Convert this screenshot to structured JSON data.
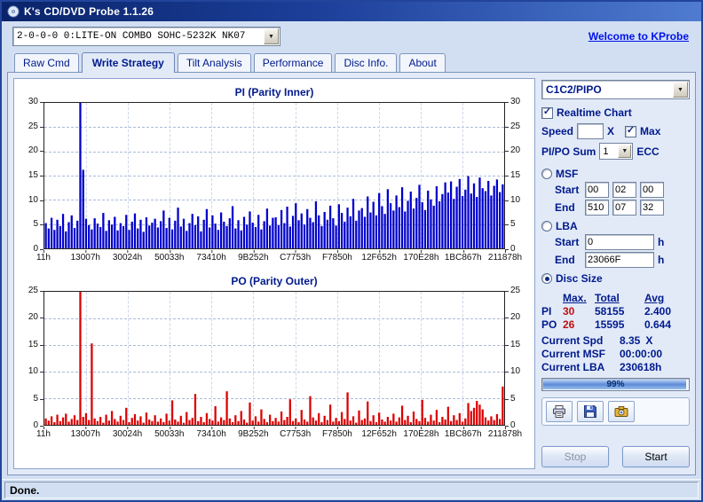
{
  "window": {
    "title": "K's CD/DVD Probe 1.1.26"
  },
  "toolbar": {
    "device": "2-0-0-0 0:LITE-ON COMBO SOHC-5232K NK07",
    "link": "Welcome to KProbe"
  },
  "tabs": [
    {
      "label": "Raw Cmd",
      "active": false
    },
    {
      "label": "Write Strategy",
      "active": true
    },
    {
      "label": "Tilt Analysis",
      "active": false
    },
    {
      "label": "Performance",
      "active": false
    },
    {
      "label": "Disc Info.",
      "active": false
    },
    {
      "label": "About",
      "active": false
    }
  ],
  "chart_data": [
    {
      "type": "bar",
      "title": "PI (Parity Inner)",
      "color": "#0000cc",
      "ylim": [
        0,
        30
      ],
      "ytick": 5,
      "x_labels": [
        "11h",
        "13007h",
        "30024h",
        "50033h",
        "73410h",
        "9B252h",
        "C7753h",
        "F7850h",
        "12F652h",
        "170E28h",
        "1BC867h",
        "211878h"
      ],
      "values": [
        5.2,
        4.1,
        6.3,
        3.8,
        5.9,
        4.6,
        7.1,
        3.5,
        5.4,
        6.8,
        4.2,
        5.7,
        30,
        16.2,
        6.1,
        4.8,
        3.9,
        6.2,
        5.1,
        4.4,
        7.3,
        3.6,
        5.8,
        4.9,
        6.5,
        3.7,
        5.2,
        4.6,
        6.9,
        3.8,
        5.5,
        7.2,
        4.1,
        5.9,
        3.4,
        6.4,
        4.7,
        5.3,
        6.1,
        4.3,
        5.6,
        7.8,
        4.2,
        6.3,
        3.9,
        5.7,
        8.4,
        4.5,
        6.1,
        3.6,
        5.2,
        7.1,
        4.8,
        6.6,
        3.5,
        5.9,
        8.1,
        4.3,
        6.8,
        5.1,
        3.8,
        7.4,
        5.5,
        4.6,
        6.2,
        8.7,
        4.1,
        5.8,
        3.7,
        6.5,
        4.9,
        7.6,
        5.3,
        4.4,
        6.9,
        3.9,
        5.6,
        8.2,
        4.7,
        6.3,
        6.4,
        4.8,
        7.9,
        5.2,
        8.6,
        4.5,
        6.7,
        9.3,
        5.8,
        7.2,
        4.9,
        8.1,
        6.3,
        5.4,
        9.7,
        6.8,
        4.6,
        7.5,
        5.9,
        8.8,
        6.2,
        4.7,
        9.1,
        7.3,
        5.5,
        8.4,
        6.6,
        10.2,
        5.7,
        7.8,
        8.3,
        6.5,
        10.7,
        7.4,
        9.6,
        6.8,
        11.4,
        8.7,
        7.1,
        12.2,
        9.3,
        7.8,
        10.9,
        8.5,
        12.6,
        7.6,
        9.8,
        11.7,
        8.2,
        10.4,
        13.1,
        9.5,
        7.9,
        11.9,
        10.1,
        8.8,
        12.8,
        9.7,
        11.2,
        13.6,
        11.5,
        13.8,
        10.2,
        12.7,
        14.3,
        10.8,
        12.1,
        14.9,
        11.3,
        13.4,
        10.6,
        14.6,
        12.4,
        11.8,
        13.9,
        10.9,
        12.9,
        14.2,
        11.6,
        13.2
      ]
    },
    {
      "type": "bar",
      "title": "PO (Parity Outer)",
      "color": "#dd0000",
      "ylim": [
        0,
        25
      ],
      "ytick": 5,
      "x_labels": [
        "11h",
        "13007h",
        "30024h",
        "50033h",
        "73410h",
        "9B252h",
        "C7753h",
        "F7850h",
        "12F652h",
        "170E28h",
        "1BC867h",
        "211878h"
      ],
      "values": [
        1.2,
        0.8,
        1.6,
        0.5,
        1.9,
        0.7,
        1.4,
        2.1,
        0.6,
        1.1,
        1.8,
        0.9,
        25,
        1.5,
        2.2,
        0.9,
        15.3,
        1.2,
        0.7,
        1.5,
        0.4,
        1.9,
        0.8,
        2.6,
        1.1,
        0.6,
        1.7,
        0.9,
        3.2,
        0.5,
        1.3,
        2.0,
        0.8,
        1.6,
        0.4,
        2.3,
        1.0,
        0.7,
        1.8,
        0.6,
        1.2,
        0.5,
        2.1,
        0.8,
        4.6,
        1.0,
        0.6,
        1.7,
        0.4,
        2.4,
        0.9,
        1.3,
        5.8,
        0.7,
        1.5,
        0.5,
        2.2,
        1.1,
        0.8,
        3.5,
        0.6,
        1.4,
        0.9,
        6.3,
        1.2,
        0.5,
        1.8,
        0.7,
        2.6,
        1.0,
        0.4,
        4.2,
        0.8,
        1.6,
        0.6,
        2.9,
        1.1,
        0.5,
        1.9,
        0.7,
        1.3,
        0.6,
        2.5,
        0.9,
        1.5,
        4.8,
        0.7,
        1.2,
        0.5,
        2.8,
        1.0,
        0.6,
        5.4,
        1.4,
        0.8,
        2.2,
        0.5,
        1.7,
        0.9,
        3.8,
        0.6,
        1.3,
        0.7,
        2.4,
        1.1,
        6.1,
        0.8,
        1.6,
        0.4,
        2.7,
        0.9,
        1.2,
        4.4,
        0.7,
        1.8,
        0.5,
        2.3,
        1.0,
        0.6,
        1.5,
        0.8,
        2.1,
        0.6,
        1.4,
        3.6,
        0.9,
        1.7,
        0.5,
        2.5,
        1.1,
        0.7,
        4.7,
        1.3,
        0.6,
        1.9,
        0.8,
        2.8,
        0.5,
        1.5,
        1.0,
        3.4,
        0.7,
        1.8,
        0.9,
        2.2,
        0.6,
        1.2,
        4.1,
        2.6,
        3.2,
        4.5,
        3.8,
        2.9,
        1.4,
        0.8,
        1.6,
        0.9,
        2.0,
        1.1,
        7.2
      ]
    }
  ],
  "side": {
    "mode_select": "C1C2/PIPO",
    "realtime_label": "Realtime Chart",
    "realtime_checked": true,
    "speed_label": "Speed",
    "speed_value": "",
    "speed_x": "X",
    "max_label": "Max",
    "max_checked": true,
    "pipo_sum_label": "PI/PO Sum",
    "pipo_sum_value": "1",
    "ecc_label": "ECC",
    "msf": {
      "label": "MSF",
      "selected": false,
      "start_label": "Start",
      "end_label": "End",
      "start": [
        "00",
        "02",
        "00"
      ],
      "end": [
        "510",
        "07",
        "32"
      ]
    },
    "lba": {
      "label": "LBA",
      "selected": false,
      "start_label": "Start",
      "end_label": "End",
      "start": "0",
      "end": "23066F",
      "unit": "h"
    },
    "disc_size_label": "Disc Size",
    "disc_size_selected": true,
    "stats": {
      "headers": [
        "Max.",
        "Total",
        "Avg"
      ],
      "rows": [
        {
          "name": "PI",
          "max": "30",
          "total": "58155",
          "avg": "2.400"
        },
        {
          "name": "PO",
          "max": "26",
          "total": "15595",
          "avg": "0.644"
        }
      ]
    },
    "current_spd": {
      "label": "Current Spd",
      "value": "8.35",
      "suffix": "X"
    },
    "current_msf": {
      "label": "Current MSF",
      "value": "00:00:00",
      "suffix": ""
    },
    "current_lba": {
      "label": "Current LBA",
      "value": "230618h",
      "suffix": ""
    },
    "progress": {
      "percent": 99,
      "text": "99%"
    },
    "buttons": {
      "stop": "Stop",
      "start": "Start"
    }
  },
  "status": {
    "text": "Done."
  }
}
